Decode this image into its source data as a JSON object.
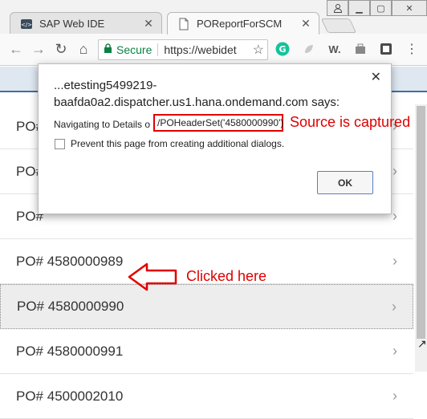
{
  "browser": {
    "tabs": [
      {
        "label": "SAP Web IDE",
        "active": false
      },
      {
        "label": "POReportForSCM",
        "active": true
      }
    ],
    "address": {
      "secure_label": "Secure",
      "url": "https://webidet"
    }
  },
  "dialog": {
    "heading": "...etesting5499219-baafda0a2.dispatcher.us1.hana.ondemand.com says:",
    "message_prefix": "Navigating to Details o",
    "message_path": "/POHeaderSet('4580000990')",
    "checkbox_label": "Prevent this page from creating additional dialogs.",
    "ok_label": "OK"
  },
  "list": {
    "items": [
      {
        "label": "PO#"
      },
      {
        "label": "PO#"
      },
      {
        "label": "PO#"
      },
      {
        "label": "PO# 4580000989"
      },
      {
        "label": "PO# 4580000990",
        "selected": true
      },
      {
        "label": "PO# 4580000991"
      },
      {
        "label": "PO# 4500002010"
      }
    ]
  },
  "annotations": {
    "source": "Source is captured",
    "clicked": "Clicked here",
    "color": "#e00000"
  },
  "colors": {
    "accent": "#3f6ea6",
    "secure": "#0b8043"
  }
}
